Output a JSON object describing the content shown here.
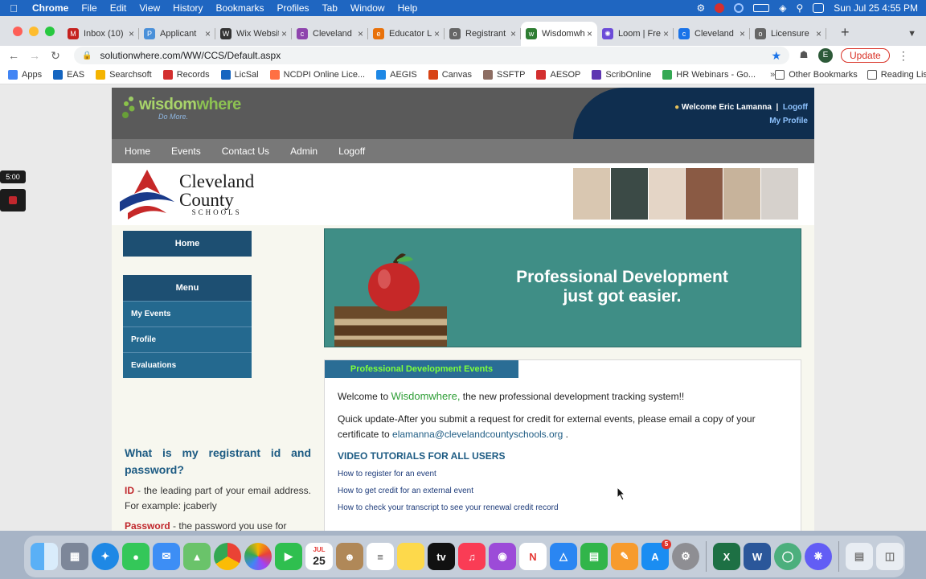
{
  "menubar": {
    "app": "Chrome",
    "items": [
      "File",
      "Edit",
      "View",
      "History",
      "Bookmarks",
      "Profiles",
      "Tab",
      "Window",
      "Help"
    ],
    "clock": "Sun Jul 25  4:55 PM"
  },
  "tabs": [
    {
      "label": "Inbox (10)",
      "color": "#c5221f",
      "icon": "M"
    },
    {
      "label": "Applicant",
      "color": "#4a90d9",
      "icon": "P"
    },
    {
      "label": "Wix Website",
      "color": "#333333",
      "icon": "W"
    },
    {
      "label": "Cleveland",
      "color": "#8e44ad",
      "icon": "c"
    },
    {
      "label": "Educator L",
      "color": "#e8710a",
      "icon": "e"
    },
    {
      "label": "Registrant",
      "color": "#666666",
      "icon": "o"
    },
    {
      "label": "Wisdomwhere",
      "color": "#2e7d32",
      "icon": "w",
      "active": true
    },
    {
      "label": "Loom | Free",
      "color": "#6c4bd8",
      "icon": "✺"
    },
    {
      "label": "Cleveland",
      "color": "#1a73e8",
      "icon": "c"
    },
    {
      "label": "Licensure",
      "color": "#666666",
      "icon": "o"
    }
  ],
  "address": {
    "url": "solutionwhere.com/WW/CCS/Default.aspx",
    "update_label": "Update",
    "profile_initial": "E"
  },
  "bookmarks": {
    "items": [
      {
        "label": "Apps",
        "color": "#4285f4"
      },
      {
        "label": "EAS",
        "color": "#1565c0"
      },
      {
        "label": "Searchsoft",
        "color": "#f4b400"
      },
      {
        "label": "Records",
        "color": "#d32f2f"
      },
      {
        "label": "LicSal",
        "color": "#1565c0"
      },
      {
        "label": "NCDPI Online Lice...",
        "color": "#ff7043"
      },
      {
        "label": "AEGIS",
        "color": "#1e88e5"
      },
      {
        "label": "Canvas",
        "color": "#d84315"
      },
      {
        "label": "SSFTP",
        "color": "#8d6e63"
      },
      {
        "label": "AESOP",
        "color": "#d32f2f"
      },
      {
        "label": "ScribOnline",
        "color": "#5e35b1"
      },
      {
        "label": "HR Webinars - Go...",
        "color": "#34a853"
      }
    ],
    "other": "Other Bookmarks",
    "reading_list": "Reading List"
  },
  "recorder": {
    "timer": "5:00"
  },
  "site": {
    "logo_main": "wisdom",
    "logo_accent": "where",
    "logo_tagline": "Do More.",
    "welcome_user": "Welcome Eric Lamanna",
    "logoff": "Logoff",
    "my_profile": "My Profile",
    "nav": [
      "Home",
      "Events",
      "Contact Us",
      "Admin",
      "Logoff"
    ],
    "district_line1": "Cleveland",
    "district_line2": "County",
    "district_line3": "SCHOOLS",
    "left_home": "Home",
    "menu_title": "Menu",
    "menu_items": [
      "My Events",
      "Profile",
      "Evaluations"
    ],
    "hero_line1": "Professional Development",
    "hero_line2": "just got easier.",
    "events_tab": "Professional Development Events",
    "welcome_prefix": "Welcome to ",
    "welcome_brand": "Wisdomwhere,",
    "welcome_suffix": " the new professional development tracking system!!",
    "update_text": "Quick update-After you submit a request for credit for external events, please email a copy of your certificate to ",
    "update_email": "elamanna@clevelandcountyschools.org",
    "update_end": " .",
    "video_heading": "VIDEO TUTORIALS FOR ALL USERS",
    "video_links": [
      "How to register for an event",
      "How to get credit for an external event",
      "How to check your transcript to see your renewal credit record"
    ],
    "faq_question": "What is my registrant id and password?",
    "faq_id_label": "ID",
    "faq_id_text": " - the leading part of your email address. For example: jcaberly",
    "faq_pw_label": "Password",
    "faq_pw_text": " - the password you use for"
  },
  "dock": {
    "calendar_month": "JUL",
    "calendar_day": "25",
    "appstore_badge": "5"
  }
}
